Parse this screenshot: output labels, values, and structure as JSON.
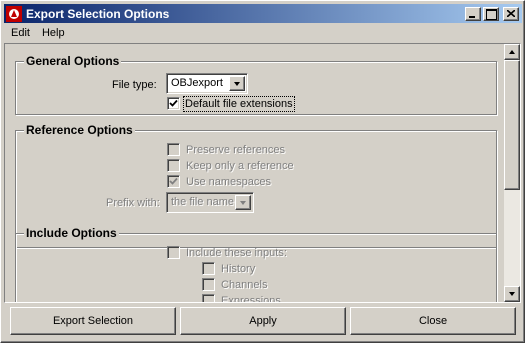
{
  "window": {
    "title": "Export Selection Options",
    "icon": "maya-app-icon",
    "controls": [
      "minimize-icon",
      "maximize-icon",
      "close-icon"
    ]
  },
  "menu": {
    "items": [
      "Edit",
      "Help"
    ]
  },
  "general_options": {
    "title": "General Options",
    "file_type_label": "File type:",
    "file_type_value": "OBJexport",
    "default_ext_label": "Default file extensions",
    "default_ext_checked": true
  },
  "reference_options": {
    "title": "Reference Options",
    "preserve_label": "Preserve references",
    "preserve_checked": false,
    "keep_label": "Keep only a reference",
    "keep_checked": false,
    "namespaces_label": "Use namespaces",
    "namespaces_checked": true,
    "prefix_label": "Prefix with:",
    "prefix_value": "the file name"
  },
  "include_options": {
    "title": "Include Options",
    "include_inputs_label": "Include these inputs:",
    "include_inputs_checked": false,
    "history_label": "History",
    "channels_label": "Channels",
    "expressions_label": "Expressions"
  },
  "buttons": {
    "export": "Export Selection",
    "apply": "Apply",
    "close": "Close"
  },
  "colors": {
    "title_gradient_start": "#0a246a",
    "title_gradient_end": "#a6caf0",
    "face": "#d4d0c8"
  }
}
